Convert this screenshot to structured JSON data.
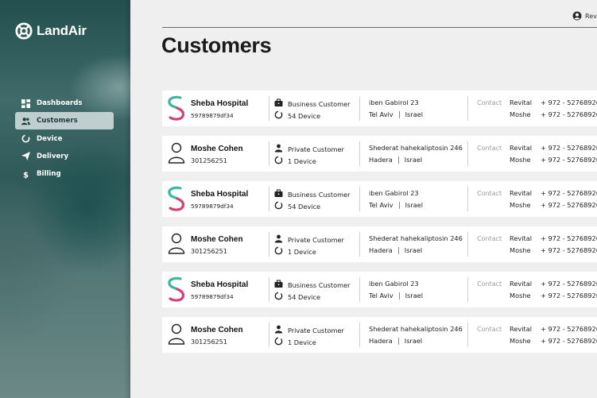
{
  "app": {
    "brand": "LandAir"
  },
  "header": {
    "user_name": "Rev",
    "page_title": "Customers"
  },
  "sidebar": {
    "items": [
      {
        "label": "Dashboards",
        "icon": "dashboard-icon",
        "active": false
      },
      {
        "label": "Customers",
        "icon": "users-icon",
        "active": true
      },
      {
        "label": "Device",
        "icon": "device-icon",
        "active": false
      },
      {
        "label": "Delivery",
        "icon": "send-icon",
        "active": false
      },
      {
        "label": "Billing",
        "icon": "dollar-icon",
        "active": false
      }
    ]
  },
  "customers": [
    {
      "name": "Sheba Hospital",
      "id": "59789879df34",
      "avatar": "sheba-logo-icon",
      "type": "Business Customer",
      "type_icon": "briefcase-icon",
      "devices": "54 Device",
      "street": "iben Gabirol 23",
      "city": "Tel Aviv",
      "country": "Israel",
      "contact_label": "Contact",
      "contact_1": "Revital",
      "contact_2": "Moshe",
      "phone_1": "+ 972 - 52768926",
      "phone_2": "+ 972 - 52768926"
    },
    {
      "name": "Moshe Cohen",
      "id": "301256251",
      "avatar": "person-outline-icon",
      "type": "Private Customer",
      "type_icon": "person-icon",
      "devices": "1 Device",
      "street": "Shederat hahekaliptosin 246",
      "city": "Hadera",
      "country": "Israel",
      "contact_label": "Contact",
      "contact_1": "Revital",
      "contact_2": "Moshe",
      "phone_1": "+ 972 - 52768926",
      "phone_2": "+ 972 - 52768926"
    },
    {
      "name": "Sheba Hospital",
      "id": "59789879df34",
      "avatar": "sheba-logo-icon",
      "type": "Business Customer",
      "type_icon": "briefcase-icon",
      "devices": "54 Device",
      "street": "iben Gabirol 23",
      "city": "Tel Aviv",
      "country": "Israel",
      "contact_label": "Contact",
      "contact_1": "Revital",
      "contact_2": "Moshe",
      "phone_1": "+ 972 - 52768926",
      "phone_2": "+ 972 - 52768926"
    },
    {
      "name": "Moshe Cohen",
      "id": "301256251",
      "avatar": "person-outline-icon",
      "type": "Private Customer",
      "type_icon": "person-icon",
      "devices": "1 Device",
      "street": "Shederat hahekaliptosin 246",
      "city": "Hadera",
      "country": "Israel",
      "contact_label": "Contact",
      "contact_1": "Revital",
      "contact_2": "Moshe",
      "phone_1": "+ 972 - 52768926",
      "phone_2": "+ 972 - 52768926"
    },
    {
      "name": "Sheba Hospital",
      "id": "59789879df34",
      "avatar": "sheba-logo-icon",
      "type": "Business Customer",
      "type_icon": "briefcase-icon",
      "devices": "54 Device",
      "street": "iben Gabirol 23",
      "city": "Tel Aviv",
      "country": "Israel",
      "contact_label": "Contact",
      "contact_1": "Revital",
      "contact_2": "Moshe",
      "phone_1": "+ 972 - 52768926",
      "phone_2": "+ 972 - 52768926"
    },
    {
      "name": "Moshe Cohen",
      "id": "301256251",
      "avatar": "person-outline-icon",
      "type": "Private Customer",
      "type_icon": "person-icon",
      "devices": "1 Device",
      "street": "Shederat hahekaliptosin 246",
      "city": "Hadera",
      "country": "Israel",
      "contact_label": "Contact",
      "contact_1": "Revital",
      "contact_2": "Moshe",
      "phone_1": "+ 972 - 52768926",
      "phone_2": "+ 972 - 52768926"
    }
  ],
  "colors": {
    "sidebar_teal": "#2f5a59",
    "logo_green": "#3fb6a0",
    "logo_pink": "#d83f7a",
    "background": "#efefef"
  }
}
